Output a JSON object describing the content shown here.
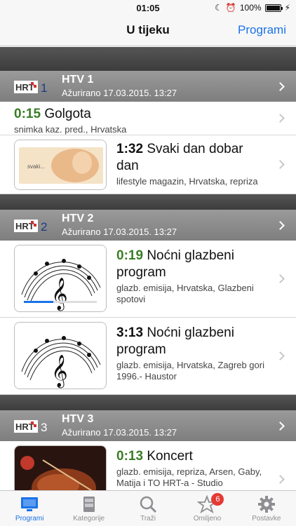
{
  "status": {
    "time": "01:05",
    "battery": "100%"
  },
  "nav": {
    "title": "U tijeku",
    "action": "Programi"
  },
  "channels": [
    {
      "name": "HTV 1",
      "logo_text": "HRT",
      "logo_num": "1",
      "updated": "Ažurirano 17.03.2015. 13:27",
      "programs": [
        {
          "time": "0:15",
          "title": "Golgota",
          "subtitle": "snimka kaz. pred., Hrvatska"
        },
        {
          "time": "1:32",
          "title": "Svaki dan dobar dan",
          "subtitle": "lifestyle magazin, Hrvatska, repriza",
          "thumb_text": "svaki..."
        }
      ]
    },
    {
      "name": "HTV 2",
      "logo_text": "HRT",
      "logo_num": "2",
      "updated": "Ažurirano 17.03.2015. 13:27",
      "programs": [
        {
          "time": "0:19",
          "title": "Noćni glazbeni program",
          "subtitle": "glazb. emisija, Hrvatska, Glazbeni spotovi",
          "progress": 0.4
        },
        {
          "time": "3:13",
          "title": "Noćni glazbeni program",
          "subtitle": "glazb. emisija, Hrvatska, Zagreb gori 1996.- Haustor"
        }
      ]
    },
    {
      "name": "HTV 3",
      "logo_text": "HRT",
      "logo_num": "3",
      "updated": "Ažurirano 17.03.2015. 13:27",
      "programs": [
        {
          "time": "0:13",
          "title": "Koncert",
          "subtitle": "glazb. emisija, repriza, Arsen, Gaby, Matija i TO HRT-a - Studio"
        }
      ]
    }
  ],
  "tabs": [
    {
      "label": "Programi",
      "icon": "tv-icon",
      "active": true
    },
    {
      "label": "Kategorije",
      "icon": "cabinet-icon"
    },
    {
      "label": "Traži",
      "icon": "search-icon"
    },
    {
      "label": "Omiljeno",
      "icon": "star-icon",
      "badge": "6"
    },
    {
      "label": "Postavke",
      "icon": "gear-icon"
    }
  ],
  "colors": {
    "accent": "#1a73e8",
    "time_green": "#3a7d27",
    "header_gray": "#8a8a8a",
    "badge_red": "#e53935"
  }
}
